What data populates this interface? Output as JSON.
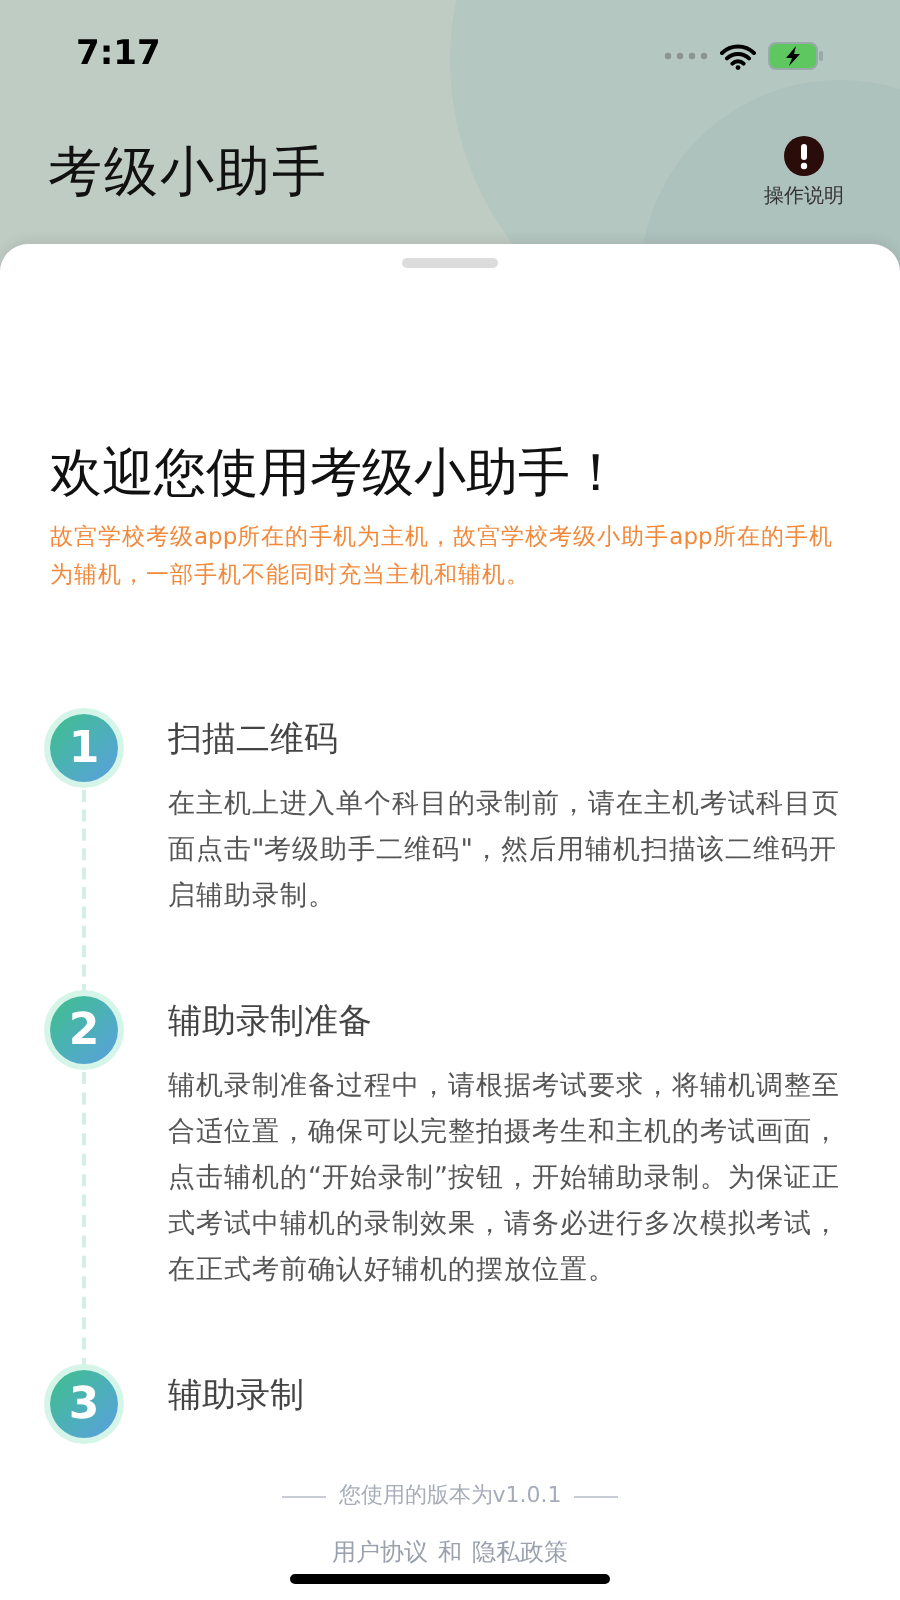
{
  "status_bar": {
    "time": "7:17"
  },
  "header": {
    "title": "考级小助手",
    "help_label": "操作说明"
  },
  "welcome": {
    "title": "欢迎您使用考级小助手！",
    "note": "故宫学校考级app所在的手机为主机，故宫学校考级小助手app所在的手机为辅机，一部手机不能同时充当主机和辅机。"
  },
  "steps": [
    {
      "number": "1",
      "title": "扫描二维码",
      "text": "在主机上进入单个科目的录制前，请在主机考试科目页面点击\"考级助手二维码\"，然后用辅机扫描该二维码开启辅助录制。"
    },
    {
      "number": "2",
      "title": "辅助录制准备",
      "text": "辅机录制准备过程中，请根据考试要求，将辅机调整至合适位置，确保可以完整拍摄考生和主机的考试画面，点击辅机的“开始录制”按钮，开始辅助录制。为保证正式考试中辅机的录制效果，请务必进行多次模拟考试，在正式考前确认好辅机的摆放位置。"
    },
    {
      "number": "3",
      "title": "辅助录制"
    }
  ],
  "footer": {
    "version": "您使用的版本为v1.0.1",
    "links": [
      "用户协议",
      "和",
      "隐私政策"
    ]
  }
}
